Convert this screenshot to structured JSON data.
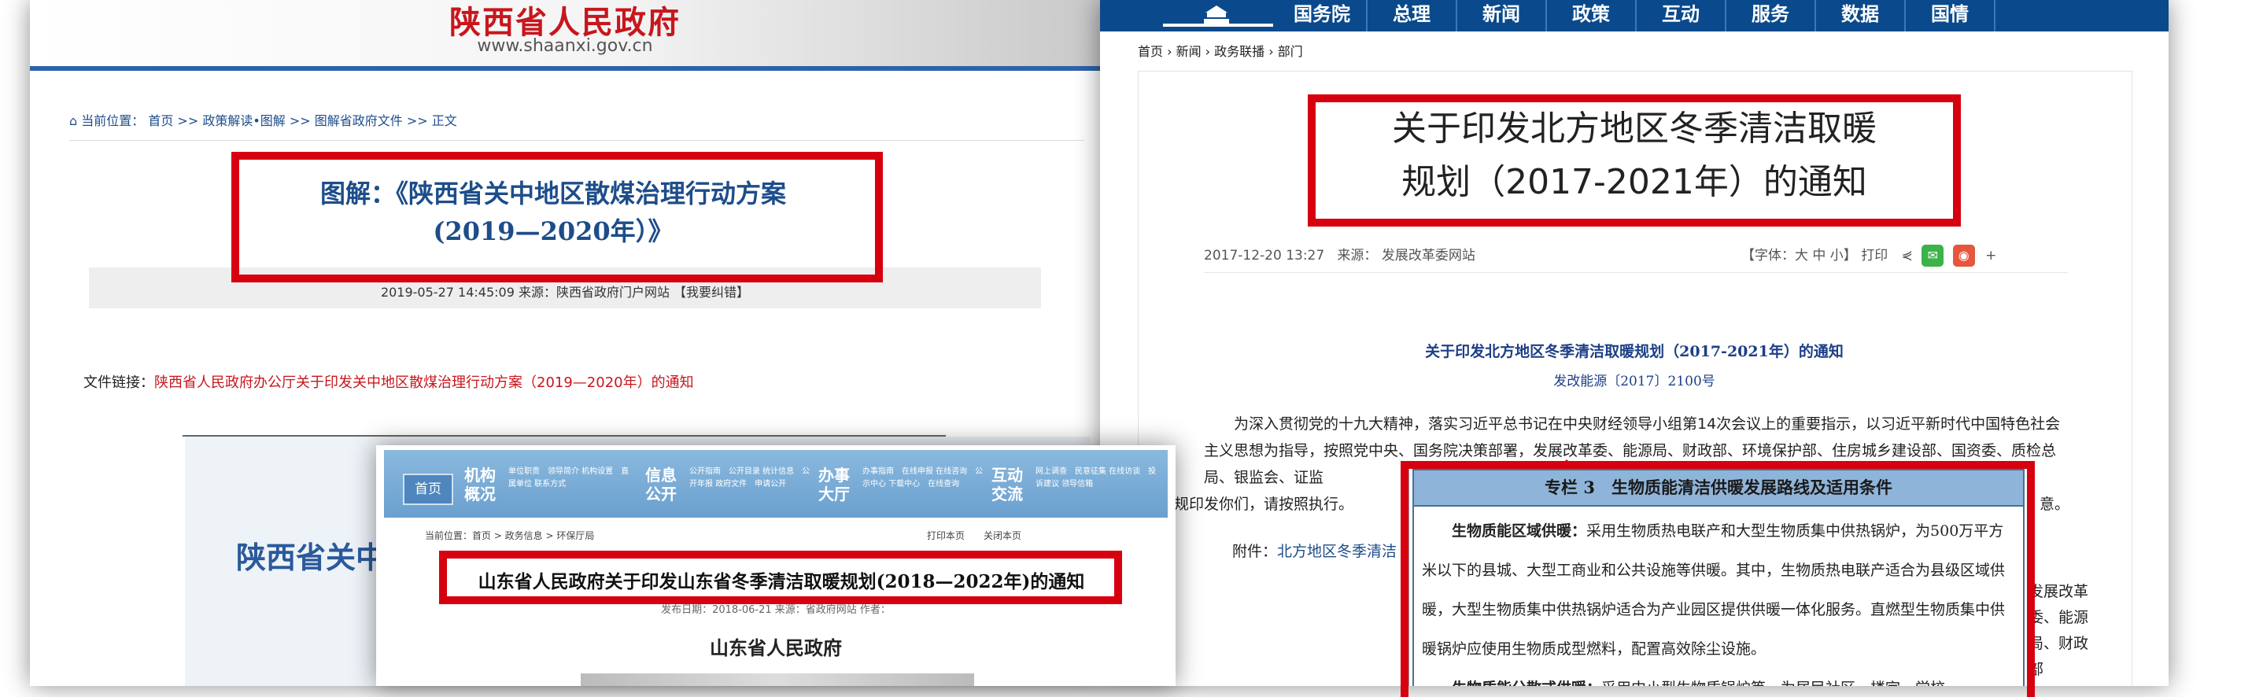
{
  "shaanxi": {
    "site_name": "陕西省人民政府",
    "site_url": "www.shaanxi.gov.cn",
    "breadcrumb": "当前位置： 首页 >> 政策解读•图解 >> 图解省政府文件 >> 正文",
    "title_line1": "图解：《陕西省关中地区散煤治理行动方案",
    "title_line2": "(2019—2020年）》",
    "meta": "2019-05-27 14:45:09   来源：陕西省政府门户网站   【我要纠错】",
    "file_link_label": "文件链接：",
    "file_link": "陕西省人民政府办公厅关于印发关中地区散煤治理行动方案（2019—2020年）的通知",
    "big_title": "陕西省关中",
    "big_paren": "（"
  },
  "national": {
    "nav": [
      "国务院",
      "总理",
      "新闻",
      "政策",
      "互动",
      "服务",
      "数据",
      "国情"
    ],
    "breadcrumb": "首页 › 新闻 › 政务联播 › 部门",
    "title_line1": "关于印发北方地区冬季清洁取暖",
    "title_line2": "规划（2017-2021年）的通知",
    "date": "2017-12-20 13:27",
    "source": "来源： 发展改革委网站",
    "tools": "【字体：大 中 小】   打印",
    "doc_title": "关于印发北方地区冬季清洁取暖规划（2017-2021年）的通知",
    "doc_number": "发改能源〔2017〕2100号",
    "paragraph": "为深入贯彻党的十九大精神，落实习近平总书记在中央财经领导小组第14次会议上的重要指示，以习近平新时代中国特色社会主义思想为指导，按照党中央、国务院决策部署，发展改革委、能源局、财政部、环境保护部、住房城乡建设部、国资委、质检总局、银监会、证监",
    "paragraph_end": "规印发你们，请按照执行。",
    "right_tail": "意。",
    "attach_label": "附件：",
    "attach_link": "北方地区冬季清洁",
    "side_text": "发展改革委、能源局、财政部"
  },
  "shandong": {
    "home": "首页",
    "nav_groups": [
      {
        "big": "机构概况",
        "small": "单位职责　领导简介 机构设置　直属单位 联系方式"
      },
      {
        "big": "信息公开",
        "small": "公开指南　公开目录 统计信息　公开年报 政府文件　申请公开"
      },
      {
        "big": "办事大厅",
        "small": "办事指南　在线申报 在线咨询　公示中心 下载中心　在线查询"
      },
      {
        "big": "互动交流",
        "small": "网上调查　民意征集 在线访谈　投诉建议 领导信箱"
      }
    ],
    "breadcrumb": "当前位置：首页 > 政务信息 > 环保厅局",
    "tools": "打印本页　　关闭本页",
    "title": "山东省人民政府关于印发山东省冬季清洁取暖规划(2018—2022年)的通知",
    "meta": "发布日期：2018-06-21   来源：省政府网站   作者：",
    "gov_name": "山东省人民政府"
  },
  "table_panel": {
    "header": "专栏 3　生物质能清洁供暖发展路线及适用条件",
    "p1_bold": "生物质能区域供暖：",
    "p1": "采用生物质热电联产和大型生物质集中供热锅炉，为500万平方米以下的县城、大型工商业和公共设施等供暖。其中，生物质热电联产适合为县级区域供暖，大型生物质集中供热锅炉适合为产业园区提供供暖一体化服务。直燃型生物质集中供暖锅炉应使用生物质成型燃料，配置高效除尘设施。",
    "p2_bold": "生物质能分散式供暖：",
    "p2": "采用中小型生物质锅炉等，为居民社区、楼宇、学校"
  },
  "colors": {
    "highlight_red": "#d7000f",
    "nav_blue": "#0a4a8c",
    "shaanxi_red": "#c8161d"
  }
}
